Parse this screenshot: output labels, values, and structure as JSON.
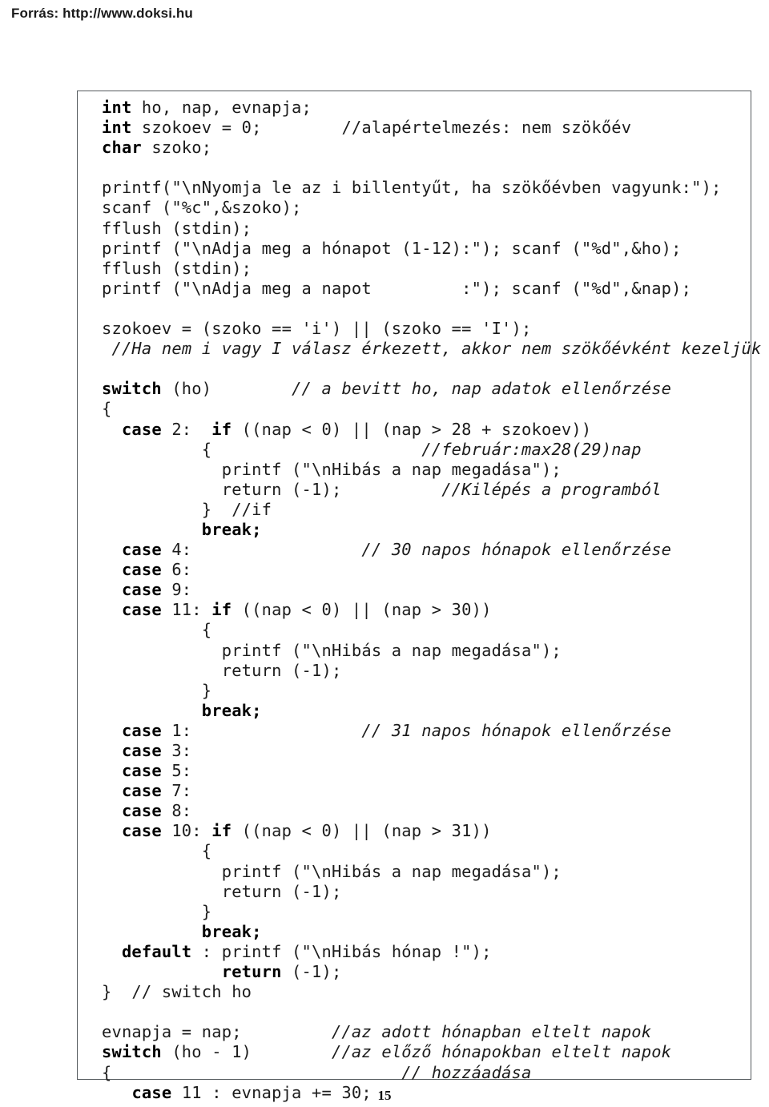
{
  "header": {
    "source_label": "Forrás: http://www.doksi.hu"
  },
  "page": {
    "number": "15"
  },
  "code_block": {
    "language": "c",
    "lines": [
      {
        "text": "int ho, nap, evnapja;",
        "spans": [
          {
            "t": "int",
            "style": "bold"
          },
          {
            "t": " ho, nap, evnapja;",
            "style": "plain"
          }
        ]
      },
      {
        "text": "int szokoev = 0;        //alapértelmezés: nem szökőév",
        "spans": [
          {
            "t": "int",
            "style": "bold"
          },
          {
            "t": " szokoev = 0;        //alapértelmezés: nem szökőév",
            "style": "plain"
          }
        ]
      },
      {
        "text": "char szoko;",
        "spans": [
          {
            "t": "char",
            "style": "bold"
          },
          {
            "t": " szoko;",
            "style": "plain"
          }
        ]
      },
      {
        "text": "",
        "spans": []
      },
      {
        "text": "printf(\"\\nNyomja le az i billentyűt, ha szökőévben vagyunk:\");",
        "spans": [
          {
            "t": "printf(\"\\nNyomja le az i billentyűt, ha szökőévben vagyunk:\");",
            "style": "plain"
          }
        ]
      },
      {
        "text": "scanf (\"%c\",&szoko);",
        "spans": [
          {
            "t": "scanf (\"%c\",&szoko);",
            "style": "plain"
          }
        ]
      },
      {
        "text": "fflush (stdin);",
        "spans": [
          {
            "t": "fflush (stdin);",
            "style": "plain"
          }
        ]
      },
      {
        "text": "printf (\"\\nAdja meg a hónapot (1-12):\"); scanf (\"%d\",&ho);",
        "spans": [
          {
            "t": "printf (\"\\nAdja meg a hónapot (1-12):\"); scanf (\"%d\",&ho);",
            "style": "plain"
          }
        ]
      },
      {
        "text": "fflush (stdin);",
        "spans": [
          {
            "t": "fflush (stdin);",
            "style": "plain"
          }
        ]
      },
      {
        "text": "printf (\"\\nAdja meg a napot         :\"); scanf (\"%d\",&nap);",
        "spans": [
          {
            "t": "printf (\"\\nAdja meg a napot         :\"); scanf (\"%d\",&nap);",
            "style": "plain"
          }
        ]
      },
      {
        "text": "",
        "spans": []
      },
      {
        "text": "szokoev = (szoko == 'i') || (szoko == 'I');",
        "spans": [
          {
            "t": "szokoev = (szoko == 'i') || (szoko == 'I');",
            "style": "plain"
          }
        ]
      },
      {
        "text": " //Ha nem i vagy I válasz érkezett, akkor nem szökőévként kezeljük !",
        "spans": [
          {
            "t": " ",
            "style": "plain"
          },
          {
            "t": "//Ha nem i vagy I válasz érkezett, akkor nem szökőévként kezeljük !",
            "style": "italic"
          }
        ]
      },
      {
        "text": "",
        "spans": []
      },
      {
        "text": "switch (ho)        // a bevitt ho, nap adatok ellenőrzése",
        "spans": [
          {
            "t": "switch",
            "style": "bold"
          },
          {
            "t": " (ho)        ",
            "style": "plain"
          },
          {
            "t": "// a bevitt ho, nap adatok ellenőrzése",
            "style": "italic"
          }
        ]
      },
      {
        "text": "{",
        "spans": [
          {
            "t": "{",
            "style": "plain"
          }
        ]
      },
      {
        "text": "  case 2:  if ((nap < 0) || (nap > 28 + szokoev))",
        "spans": [
          {
            "t": "  ",
            "style": "plain"
          },
          {
            "t": "case",
            "style": "bold"
          },
          {
            "t": " 2:  ",
            "style": "plain"
          },
          {
            "t": "if",
            "style": "bold"
          },
          {
            "t": " ((nap < 0) || (nap > 28 + szokoev))",
            "style": "plain"
          }
        ]
      },
      {
        "text": "          {                     //február:max28(29)nap",
        "spans": [
          {
            "t": "          {                     ",
            "style": "plain"
          },
          {
            "t": "//február:max28(29)nap",
            "style": "italic"
          }
        ]
      },
      {
        "text": "            printf (\"\\nHibás a nap megadása\");",
        "spans": [
          {
            "t": "            printf (\"\\nHibás a nap megadása\");",
            "style": "plain"
          }
        ]
      },
      {
        "text": "            return (-1);          //Kilépés a programból",
        "spans": [
          {
            "t": "            return (-1);          ",
            "style": "plain"
          },
          {
            "t": "//Kilépés a programból",
            "style": "italic"
          }
        ]
      },
      {
        "text": "          }  //if",
        "spans": [
          {
            "t": "          }  //if",
            "style": "plain"
          }
        ]
      },
      {
        "text": "          break;",
        "spans": [
          {
            "t": "          ",
            "style": "plain"
          },
          {
            "t": "break;",
            "style": "bold"
          }
        ]
      },
      {
        "text": "  case 4:                 // 30 napos hónapok ellenőrzése",
        "spans": [
          {
            "t": "  ",
            "style": "plain"
          },
          {
            "t": "case",
            "style": "bold"
          },
          {
            "t": " 4:                 ",
            "style": "plain"
          },
          {
            "t": "// 30 napos hónapok ellenőrzése",
            "style": "italic"
          }
        ]
      },
      {
        "text": "  case 6:",
        "spans": [
          {
            "t": "  ",
            "style": "plain"
          },
          {
            "t": "case",
            "style": "bold"
          },
          {
            "t": " 6:",
            "style": "plain"
          }
        ]
      },
      {
        "text": "  case 9:",
        "spans": [
          {
            "t": "  ",
            "style": "plain"
          },
          {
            "t": "case",
            "style": "bold"
          },
          {
            "t": " 9:",
            "style": "plain"
          }
        ]
      },
      {
        "text": "  case 11: if ((nap < 0) || (nap > 30))",
        "spans": [
          {
            "t": "  ",
            "style": "plain"
          },
          {
            "t": "case",
            "style": "bold"
          },
          {
            "t": " 11: ",
            "style": "plain"
          },
          {
            "t": "if",
            "style": "bold"
          },
          {
            "t": " ((nap < 0) || (nap > 30))",
            "style": "plain"
          }
        ]
      },
      {
        "text": "          {",
        "spans": [
          {
            "t": "          {",
            "style": "plain"
          }
        ]
      },
      {
        "text": "            printf (\"\\nHibás a nap megadása\");",
        "spans": [
          {
            "t": "            printf (\"\\nHibás a nap megadása\");",
            "style": "plain"
          }
        ]
      },
      {
        "text": "            return (-1);",
        "spans": [
          {
            "t": "            return (-1);",
            "style": "plain"
          }
        ]
      },
      {
        "text": "          }",
        "spans": [
          {
            "t": "          }",
            "style": "plain"
          }
        ]
      },
      {
        "text": "          break;",
        "spans": [
          {
            "t": "          ",
            "style": "plain"
          },
          {
            "t": "break;",
            "style": "bold"
          }
        ]
      },
      {
        "text": "  case 1:                 // 31 napos hónapok ellenőrzése",
        "spans": [
          {
            "t": "  ",
            "style": "plain"
          },
          {
            "t": "case",
            "style": "bold"
          },
          {
            "t": " 1:                 ",
            "style": "plain"
          },
          {
            "t": "// 31 napos hónapok ellenőrzése",
            "style": "italic"
          }
        ]
      },
      {
        "text": "  case 3:",
        "spans": [
          {
            "t": "  ",
            "style": "plain"
          },
          {
            "t": "case",
            "style": "bold"
          },
          {
            "t": " 3:",
            "style": "plain"
          }
        ]
      },
      {
        "text": "  case 5:",
        "spans": [
          {
            "t": "  ",
            "style": "plain"
          },
          {
            "t": "case",
            "style": "bold"
          },
          {
            "t": " 5:",
            "style": "plain"
          }
        ]
      },
      {
        "text": "  case 7:",
        "spans": [
          {
            "t": "  ",
            "style": "plain"
          },
          {
            "t": "case",
            "style": "bold"
          },
          {
            "t": " 7:",
            "style": "plain"
          }
        ]
      },
      {
        "text": "  case 8:",
        "spans": [
          {
            "t": "  ",
            "style": "plain"
          },
          {
            "t": "case",
            "style": "bold"
          },
          {
            "t": " 8:",
            "style": "plain"
          }
        ]
      },
      {
        "text": "  case 10: if ((nap < 0) || (nap > 31))",
        "spans": [
          {
            "t": "  ",
            "style": "plain"
          },
          {
            "t": "case",
            "style": "bold"
          },
          {
            "t": " 10: ",
            "style": "plain"
          },
          {
            "t": "if",
            "style": "bold"
          },
          {
            "t": " ((nap < 0) || (nap > 31))",
            "style": "plain"
          }
        ]
      },
      {
        "text": "          {",
        "spans": [
          {
            "t": "          {",
            "style": "plain"
          }
        ]
      },
      {
        "text": "            printf (\"\\nHibás a nap megadása\");",
        "spans": [
          {
            "t": "            printf (\"\\nHibás a nap megadása\");",
            "style": "plain"
          }
        ]
      },
      {
        "text": "            return (-1);",
        "spans": [
          {
            "t": "            return (-1);",
            "style": "plain"
          }
        ]
      },
      {
        "text": "          }",
        "spans": [
          {
            "t": "          }",
            "style": "plain"
          }
        ]
      },
      {
        "text": "          break;",
        "spans": [
          {
            "t": "          ",
            "style": "plain"
          },
          {
            "t": "break;",
            "style": "bold"
          }
        ]
      },
      {
        "text": "  default : printf (\"\\nHibás hónap !\");",
        "spans": [
          {
            "t": "  ",
            "style": "plain"
          },
          {
            "t": "default",
            "style": "bold"
          },
          {
            "t": " : printf (\"\\nHibás hónap !\");",
            "style": "plain"
          }
        ]
      },
      {
        "text": "            return (-1);",
        "spans": [
          {
            "t": "            ",
            "style": "plain"
          },
          {
            "t": "return",
            "style": "bold"
          },
          {
            "t": " (-1);",
            "style": "plain"
          }
        ]
      },
      {
        "text": "}  // switch ho",
        "spans": [
          {
            "t": "}  // switch ho",
            "style": "plain"
          }
        ]
      },
      {
        "text": "",
        "spans": []
      },
      {
        "text": "evnapja = nap;         //az adott hónapban eltelt napok",
        "spans": [
          {
            "t": "evnapja = nap;         ",
            "style": "plain"
          },
          {
            "t": "//az adott hónapban eltelt napok",
            "style": "italic"
          }
        ]
      },
      {
        "text": "switch (ho - 1)        //az előző hónapokban eltelt napok",
        "spans": [
          {
            "t": "switch",
            "style": "bold"
          },
          {
            "t": " (ho - 1)        ",
            "style": "plain"
          },
          {
            "t": "//az előző hónapokban eltelt napok",
            "style": "italic"
          }
        ]
      },
      {
        "text": "{                             // hozzáadása",
        "spans": [
          {
            "t": "{                             ",
            "style": "plain"
          },
          {
            "t": "// hozzáadása",
            "style": "italic"
          }
        ]
      },
      {
        "text": "   case 11 : evnapja += 30;",
        "spans": [
          {
            "t": "   ",
            "style": "plain"
          },
          {
            "t": "case",
            "style": "bold"
          },
          {
            "t": " 11 : evnapja += 30;",
            "style": "plain"
          }
        ]
      }
    ]
  }
}
